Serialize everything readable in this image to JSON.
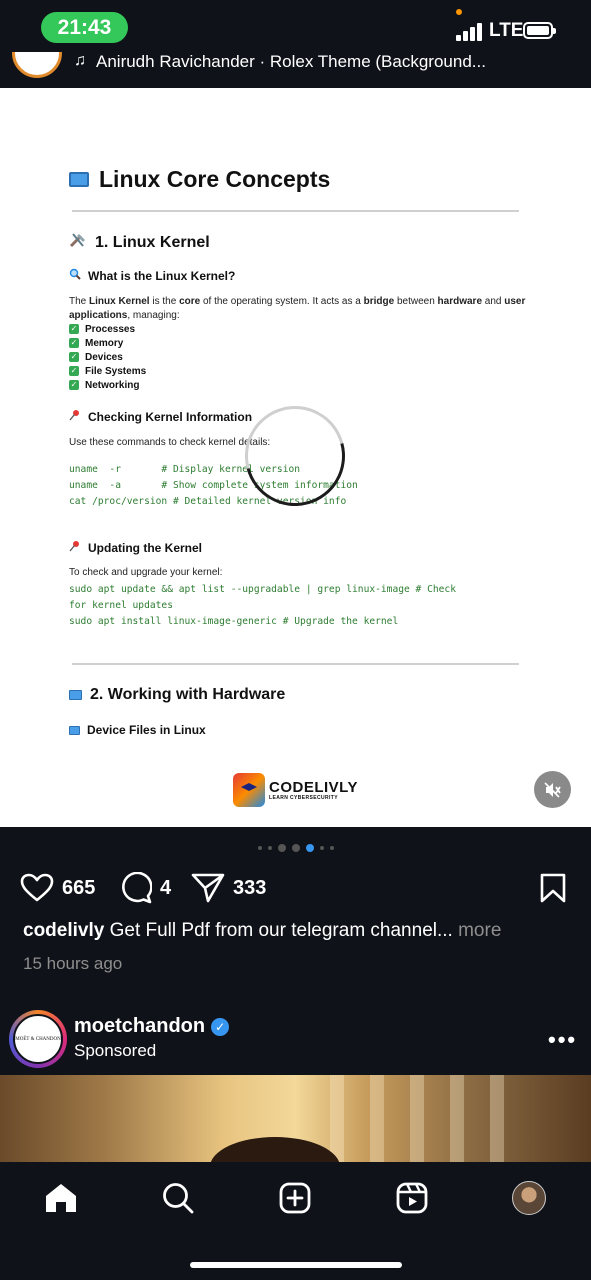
{
  "status_bar": {
    "time": "21:43",
    "network": "LTE"
  },
  "music": {
    "note": "♫",
    "text": "Anirudh Ravichander · Rolex Theme (Background..."
  },
  "doc": {
    "title": "Linux Core Concepts",
    "section1": "1. Linux Kernel",
    "what_heading": "What is the Linux Kernel?",
    "intro_parts": [
      "The ",
      "Linux Kernel",
      " is the ",
      "core",
      " of the operating system. It acts as a ",
      "bridge",
      " between ",
      "hardware",
      " and ",
      "user applications",
      ", managing:"
    ],
    "checklist": [
      "Processes",
      "Memory",
      "Devices",
      "File Systems",
      "Networking"
    ],
    "check_heading": "Checking Kernel Information",
    "check_text": "Use these commands to check kernel details:",
    "check_code": [
      "uname  -r       # Display kernel version",
      "uname  -a       # Show complete system information",
      "cat /proc/version # Detailed kernel version info"
    ],
    "update_heading": "Updating the Kernel",
    "update_text": "To check and upgrade your kernel:",
    "update_code": [
      "sudo apt update && apt list --upgradable | grep linux-image # Check",
      "for kernel updates",
      "sudo apt install linux-image-generic # Upgrade the kernel"
    ],
    "section2": "2. Working with Hardware",
    "device_heading": "Device Files in Linux",
    "logo_word": "CODELIVLY",
    "logo_sub": "LEARN CYBERSECURITY"
  },
  "carousel": {
    "count": 7,
    "active": 4
  },
  "actions": {
    "likes": "665",
    "comments": "4",
    "shares": "333"
  },
  "caption": {
    "user": "codelivly",
    "text": " Get Full Pdf from our telegram channel...",
    "more": " more"
  },
  "timestamp": "15 hours ago",
  "sponsored_post": {
    "username": "moetchandon",
    "label": "Sponsored",
    "avatar_text": "MOËT & CHANDON"
  }
}
